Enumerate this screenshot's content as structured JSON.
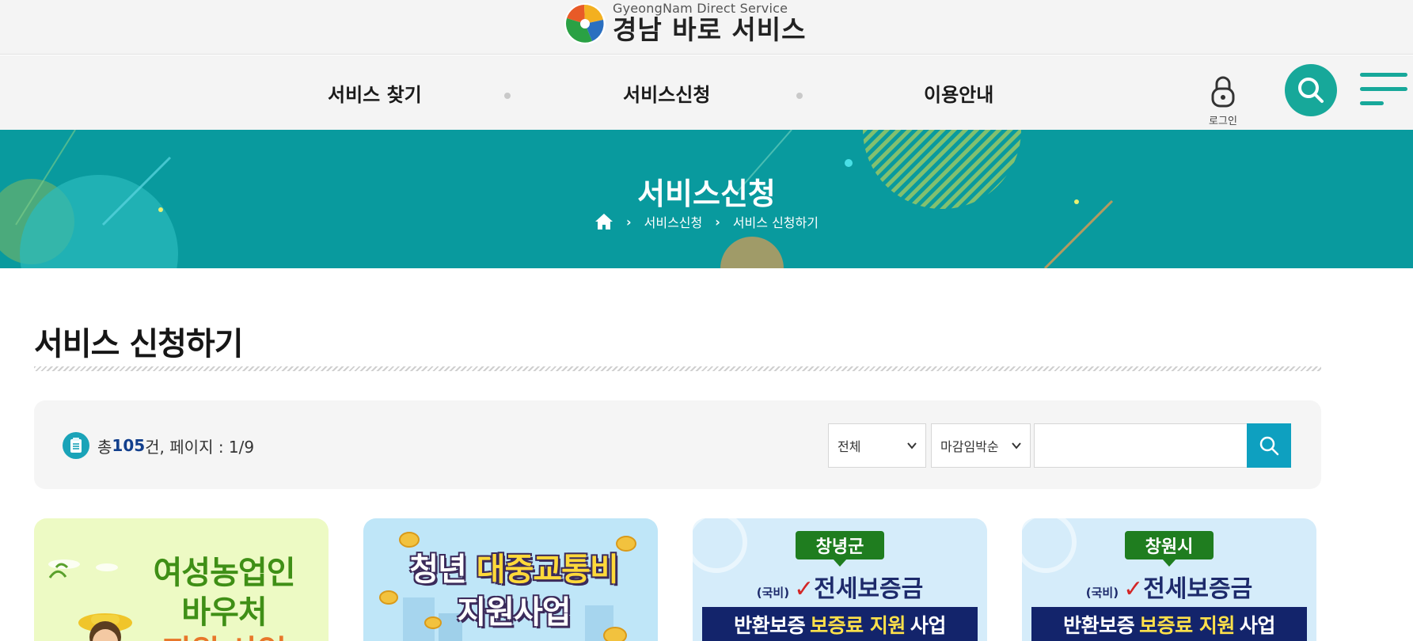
{
  "header": {
    "logo_sub": "GyeongNam Direct Service",
    "logo_main": "경남 바로 서비스",
    "logo_colors": [
      "#e85a27",
      "#f3b020",
      "#2aa144",
      "#2a6fc0"
    ]
  },
  "nav": {
    "items": [
      {
        "label": "서비스 찾기"
      },
      {
        "label": "서비스신청"
      },
      {
        "label": "이용안내"
      }
    ],
    "login_label": "로그인",
    "accent_color": "#17a89a",
    "icons": [
      "lock-icon",
      "search-icon",
      "hamburger-menu-icon"
    ]
  },
  "banner": {
    "title": "서비스신청",
    "background": "#099a9e",
    "breadcrumb": [
      "서비스신청",
      "서비스 신청하기"
    ],
    "home_icon": "home-icon"
  },
  "main": {
    "title": "서비스 신청하기",
    "filter": {
      "count_prefix": "총 ",
      "count_value": "105",
      "count_suffix": "건, 페이지 : 1/9",
      "category_select": "전체",
      "sort_select": "마감임박순",
      "search_value": "",
      "search_button_color": "#0ea0c0"
    }
  },
  "cards": [
    {
      "title_line1": "여성농업인",
      "title_line2": "바우처",
      "title_line3": "지원 사업"
    },
    {
      "title_line1_a": "청년",
      "title_line1_b": "대중교통비",
      "title_line2": "지원사업"
    },
    {
      "region": "창녕군",
      "prefix": "(국비)",
      "headline": "전세보증금",
      "strip_a": "반환보증",
      "strip_b": "보증료 지원",
      "strip_c": "사업"
    },
    {
      "region": "창원시",
      "prefix": "(국비)",
      "headline": "전세보증금",
      "strip_a": "반환보증",
      "strip_b": "보증료 지원",
      "strip_c": "사업"
    }
  ]
}
